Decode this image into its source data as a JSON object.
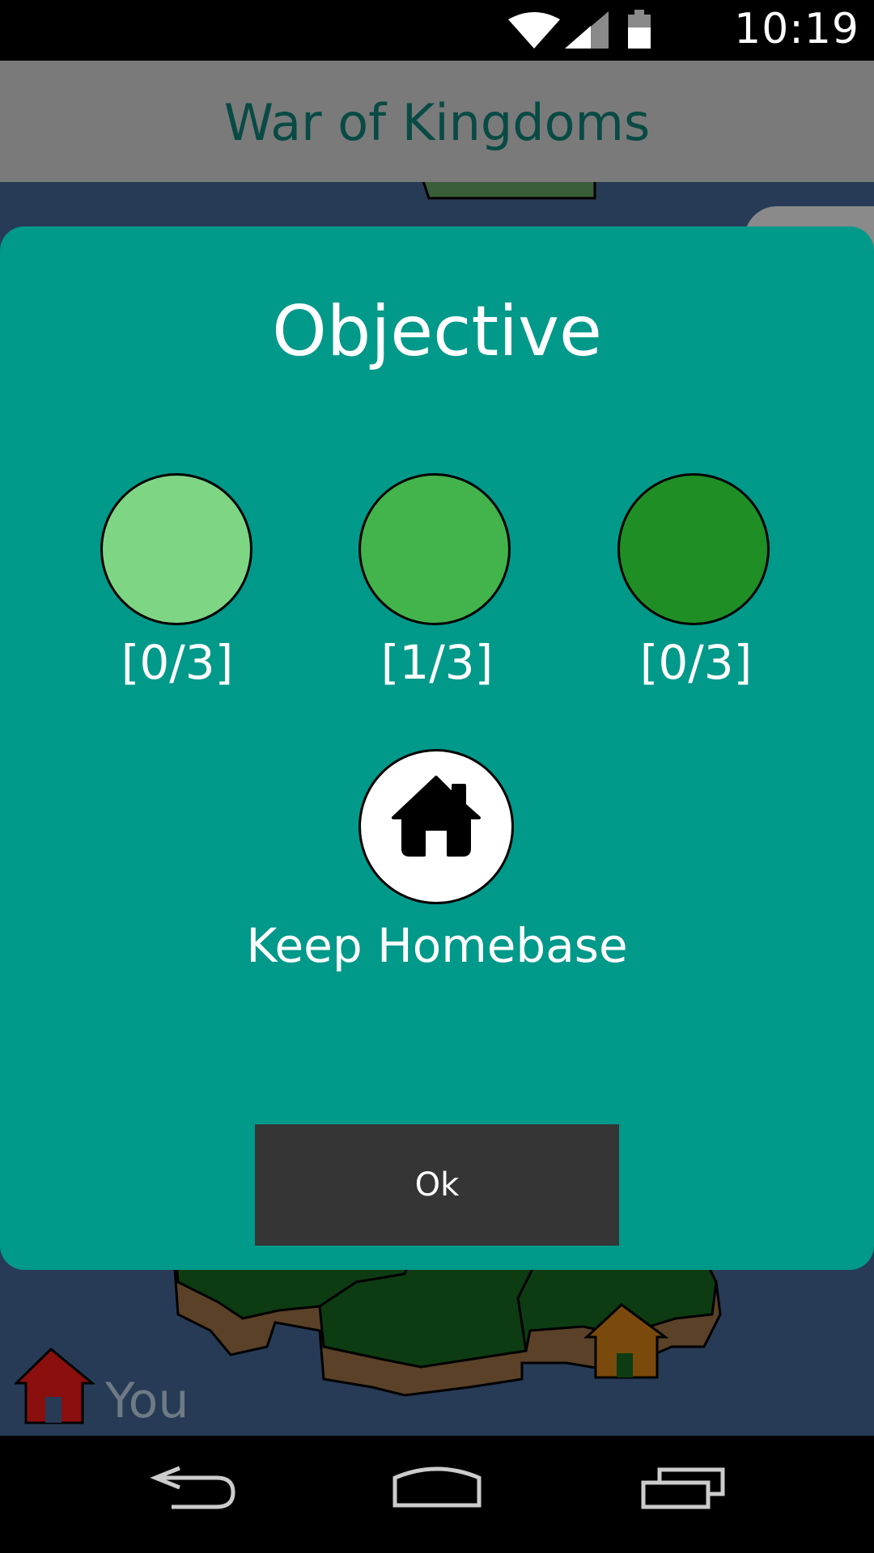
{
  "status_bar": {
    "time": "10:19",
    "icons": [
      "wifi-icon",
      "signal-icon",
      "battery-icon"
    ]
  },
  "app_bar": {
    "title": "War of Kingdoms"
  },
  "map": {
    "legend_label": "You",
    "colors": {
      "water": "#273b56",
      "player_home": "#8b0f0f",
      "enemy_home": "#7a4a0c",
      "forest": "#0d3c12",
      "dirt": "#5a4128"
    }
  },
  "dialog": {
    "title": "Objective",
    "groups": [
      {
        "color": "#7ed685",
        "count": "[0/3]"
      },
      {
        "color": "#43b34c",
        "count": "[1/3]"
      },
      {
        "color": "#1f8f25",
        "count": "[0/3]"
      }
    ],
    "objective_icon": "home-icon",
    "objective_label": "Keep Homebase",
    "ok_label": "Ok",
    "background": "#00998a"
  },
  "nav_bar": {
    "icons": [
      "back-icon",
      "home-nav-icon",
      "recent-apps-icon"
    ]
  }
}
